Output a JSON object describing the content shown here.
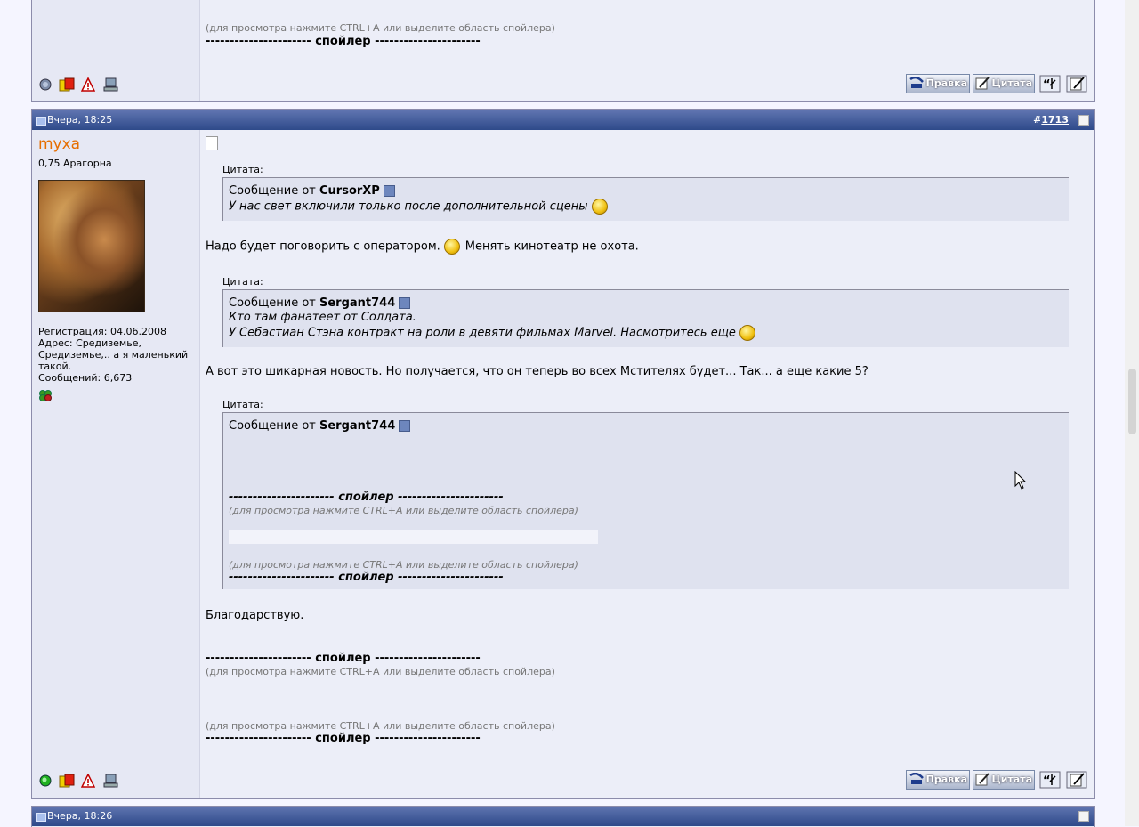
{
  "posts": {
    "top": {
      "spoiler_note": "(для просмотра нажмите CTRL+A или выделите область спойлера)",
      "spoiler_line": "---------------------- спойлер ----------------------"
    },
    "main": {
      "date": "Вчера, 18:25",
      "num_prefix": "#",
      "num": "1713",
      "username": "myxa",
      "usertitle": "0,75 Арагорна",
      "reg": "Регистрация: 04.06.2008",
      "address": "Адрес: Средиземье, Средиземье,.. а я маленький такой.",
      "messages": "Сообщений: 6,673",
      "quote_label": "Цитата:",
      "quote1_from_prefix": "Сообщение от",
      "quote1_author": "CursorXP",
      "quote1_text": "У нас свет включили только после дополнительной сцены",
      "text1": "Надо будет поговорить с оператором.",
      "text1b": "Менять кинотеатр не охота.",
      "quote2_author": "Sergant744",
      "quote2_line1": "Кто там фанатеет от Солдата.",
      "quote2_line2": "У Себастиан Стэна контракт на роли в девяти фильмах Marvel. Насмотритесь еще",
      "text2": "А вот это шикарная новость. Но получается, что он теперь во всех Мстителях будет... Так... а еще какие 5?",
      "quote3_author": "Sergant744",
      "spoiler_line": "---------------------- спойлер ----------------------",
      "spoiler_note": "(для просмотра нажмите CTRL+A или выделите область спойлера)",
      "text3": "Благодарствую."
    },
    "next": {
      "date": "Вчера, 18:26"
    }
  },
  "buttons": {
    "edit": "Правка",
    "quote": "Цитата"
  },
  "colors": {
    "header": "#2e4a8a",
    "username": "#e66e00"
  }
}
